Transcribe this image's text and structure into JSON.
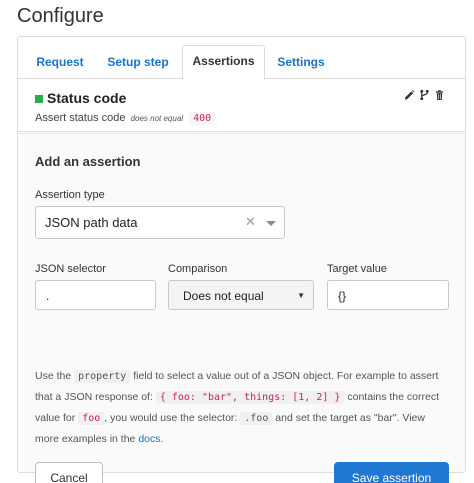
{
  "page": {
    "title": "Configure"
  },
  "tabs": [
    {
      "label": "Request",
      "active": false
    },
    {
      "label": "Setup step",
      "active": false
    },
    {
      "label": "Assertions",
      "active": true
    },
    {
      "label": "Settings",
      "active": false
    }
  ],
  "assertion": {
    "status_color": "#27ae48",
    "title": "Status code",
    "desc_prefix": "Assert status code",
    "operator": "does not equal",
    "value": "400",
    "icons": [
      "edit-icon",
      "branch-icon",
      "delete-icon"
    ]
  },
  "add_assertion": {
    "heading": "Add an assertion",
    "type_label": "Assertion type",
    "type_value": "JSON path data",
    "selector_label": "JSON selector",
    "selector_value": ".",
    "comparison_label": "Comparison",
    "comparison_value": "Does not equal",
    "target_label": "Target value",
    "target_value": "{}"
  },
  "help": {
    "t1": "Use the ",
    "c1": "property",
    "t2": " field to select a value out of a JSON object. For example to assert that a JSON response of: ",
    "c2": "{ foo: \"bar\", things: [1, 2] }",
    "t3": " contains the correct value for ",
    "c3": "foo",
    "t4": ", you would use the selector: ",
    "c4": ".foo",
    "t5": " and set the target as \"bar\". View more examples in the ",
    "link": "docs",
    "t6": "."
  },
  "buttons": {
    "cancel": "Cancel",
    "save": "Save assertion"
  },
  "colors": {
    "accent": "#1f78d1",
    "link": "#1a73c8",
    "code": "#c7254e"
  }
}
